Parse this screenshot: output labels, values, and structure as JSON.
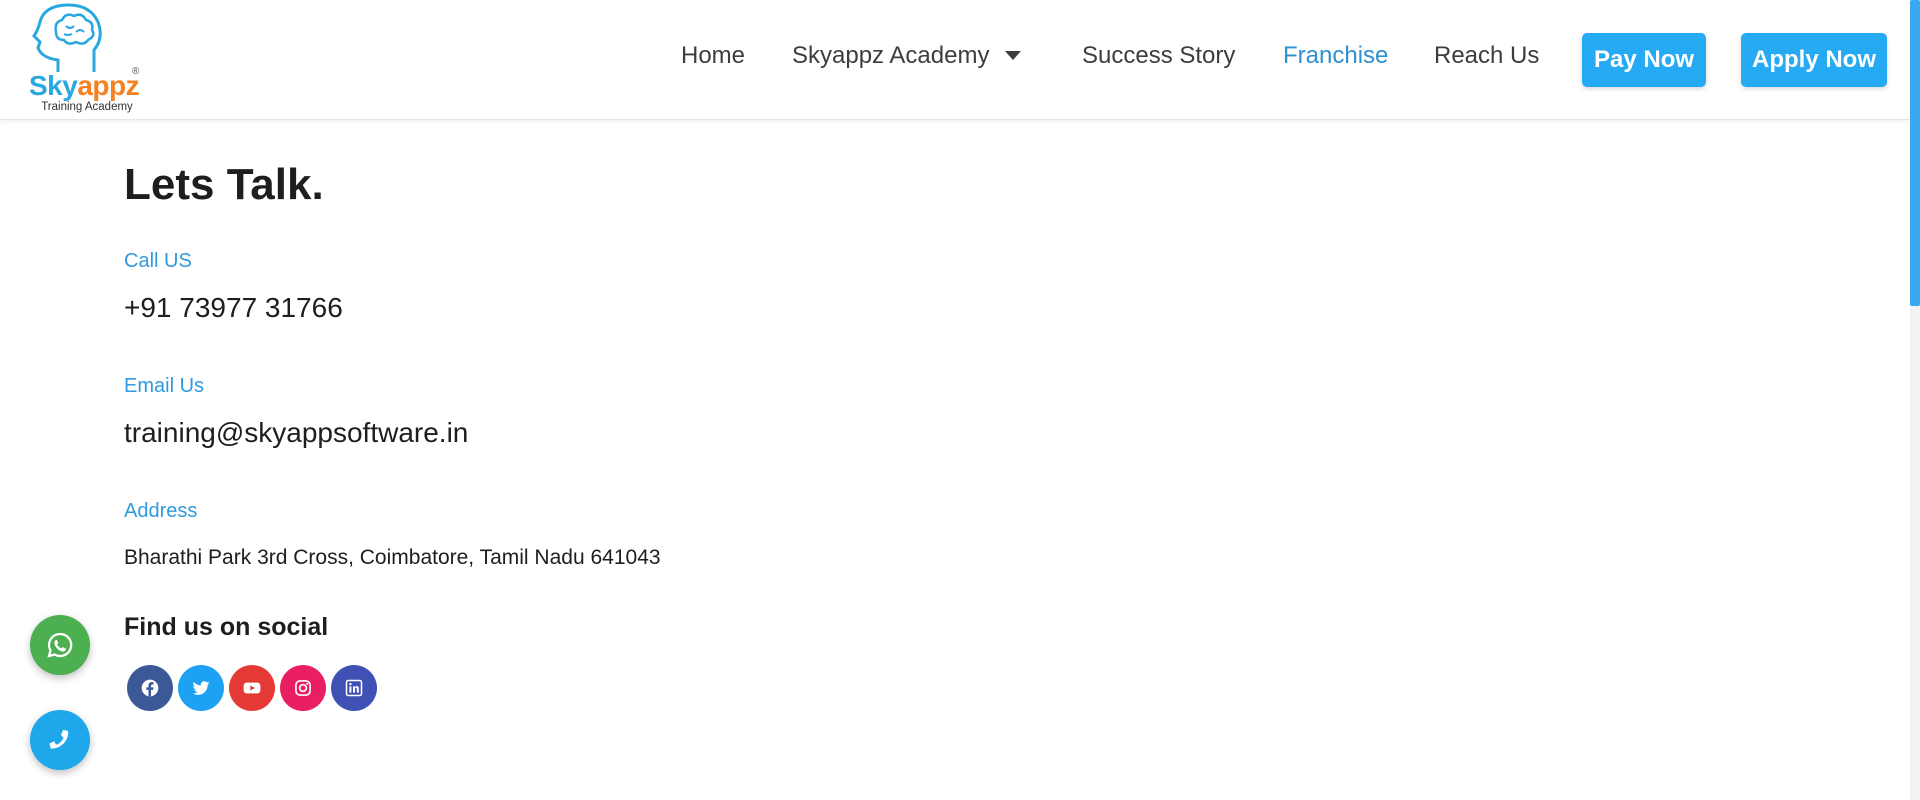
{
  "brand": {
    "name_part1": "Sky",
    "name_part2": "appz",
    "registered": "®",
    "subtitle": "Training Academy"
  },
  "nav": {
    "items": [
      {
        "label": "Home"
      },
      {
        "label": "Skyappz Academy"
      },
      {
        "label": "Success Story"
      },
      {
        "label": "Franchise"
      },
      {
        "label": "Reach Us"
      }
    ],
    "active": "Franchise",
    "pay_label": "Pay Now",
    "apply_label": "Apply Now"
  },
  "contact": {
    "title": "Lets Talk.",
    "call_label": "Call US",
    "phone": "+91 73977 31766",
    "email_label": "Email Us",
    "email": "training@skyappsoftware.in",
    "address_label": "Address",
    "address": "Bharathi Park 3rd Cross, Coimbatore, Tamil Nadu 641043",
    "social_heading": "Find us on social"
  },
  "social": [
    {
      "name": "facebook-icon",
      "color": "#3b5998"
    },
    {
      "name": "twitter-icon",
      "color": "#1da1f2"
    },
    {
      "name": "youtube-icon",
      "color": "#e53935"
    },
    {
      "name": "instagram-icon",
      "color": "#e91e63"
    },
    {
      "name": "linkedin-icon",
      "color": "#3f51b5"
    }
  ],
  "colors": {
    "accent": "#26aaf3",
    "label_blue": "#2e9ae0",
    "whatsapp": "#4caf50",
    "phone_float": "#1fa7ec"
  }
}
